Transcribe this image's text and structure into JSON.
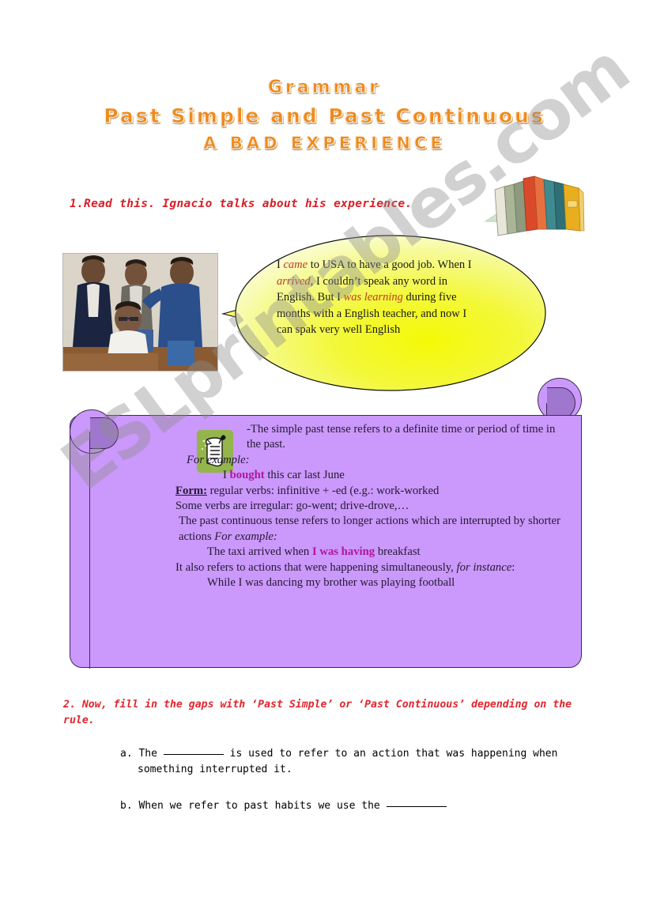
{
  "worksheet": {
    "titles": {
      "line1": "Grammar",
      "line2": "Past Simple and Past Continuous",
      "line3": "A BAD EXPERIENCE"
    },
    "task1": {
      "instruction": "1.Read this.  Ignacio talks about his experience."
    },
    "speech_bubble": {
      "segments": [
        {
          "text": "I ",
          "style": "normal"
        },
        {
          "text": "came",
          "style": "verb"
        },
        {
          "text": " to USA to have a good job. When I ",
          "style": "normal"
        },
        {
          "text": "arrived",
          "style": "verb"
        },
        {
          "text": ", I couldn’t speak any word in English. But I ",
          "style": "normal"
        },
        {
          "text": "was learning",
          "style": "verb"
        },
        {
          "text": " during five months with a English teacher, and now I can spak very well English",
          "style": "normal"
        }
      ],
      "plain_text": "I came to USA to have a good job. When I arrived, I couldn’t speak any word in English. But I was learning during five months with a English teacher, and now I can spak very well English"
    },
    "rule_box": {
      "lines": {
        "l1": "-The simple past tense refers to a definite time or period of time in the past.",
        "l2": "For example:",
        "l3_pre": "I ",
        "l3_hl": "bought",
        "l3_post": " this car last June",
        "l4_label": "Form:",
        "l4_text": " regular verbs: infinitive + -ed (e.g.: work-worked",
        "l5": "Some verbs are irregular: go-went; drive-drove,…",
        "l6_pre": "The past continuous tense refers to longer actions which are interrupted by shorter actions ",
        "l6_it": "For example:",
        "l7_pre": "The taxi arrived when ",
        "l7_hl": "I was having",
        "l7_post": " breakfast",
        "l8_pre": "It also refers to actions that were happening simultaneously, ",
        "l8_it": "for instance",
        "l8_post": ":",
        "l9": "While I was dancing my brother was playing football"
      }
    },
    "task2": {
      "instruction": "2. Now, fill in the gaps with  ‘Past Simple’  or  ‘Past Continuous’  depending on the rule.",
      "questions": [
        {
          "label": "a.",
          "before_gap": "The ",
          "after_gap": " is used to refer to an action that was happening when",
          "continuation": "something interrupted it."
        },
        {
          "label": "b.",
          "before_gap": "When we refer to past habits we use the ",
          "after_gap": "",
          "continuation": ""
        }
      ]
    },
    "watermark": {
      "text": "ESLprintables.com"
    },
    "icons": {
      "books": "books-clipart",
      "note": "note-document-icon",
      "photo": "classroom-photo"
    },
    "colors": {
      "title_orange": "#F08A1A",
      "instruction_red": "#d81f26",
      "bubble_yellow": "#f2f730",
      "scroll_purple": "#cb98fb",
      "highlight_magenta": "#b0179a",
      "note_green": "#93b54c"
    }
  }
}
